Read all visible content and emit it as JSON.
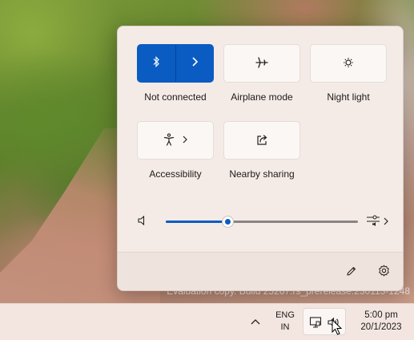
{
  "desktop": {
    "watermark": "Evaluation copy. Build 25267.rs_prerelease.230113-1248"
  },
  "quick_settings": {
    "tiles": [
      {
        "label": "Not connected",
        "icon": "bluetooth-icon",
        "active": true
      },
      {
        "label": "Airplane mode",
        "icon": "airplane-icon",
        "active": false
      },
      {
        "label": "Night light",
        "icon": "night-light-icon",
        "active": false
      },
      {
        "label": "Accessibility",
        "icon": "accessibility-icon",
        "active": false
      },
      {
        "label": "Nearby sharing",
        "icon": "share-icon",
        "active": false
      }
    ],
    "volume": {
      "level": 0.32,
      "icon": "speaker-icon",
      "output_icon": "audio-output-icon"
    },
    "footer": {
      "edit_icon": "pencil-icon",
      "settings_icon": "gear-icon"
    }
  },
  "taskbar": {
    "language_line1": "ENG",
    "language_line2": "IN",
    "time": "5:00 pm",
    "date": "20/1/2023",
    "tray_icons": [
      "network-icon",
      "volume-icon"
    ]
  },
  "colors": {
    "accent": "#0a5cc2",
    "flyout_bg": "#f5ebe6",
    "taskbar_bg": "#f3e6e0"
  }
}
